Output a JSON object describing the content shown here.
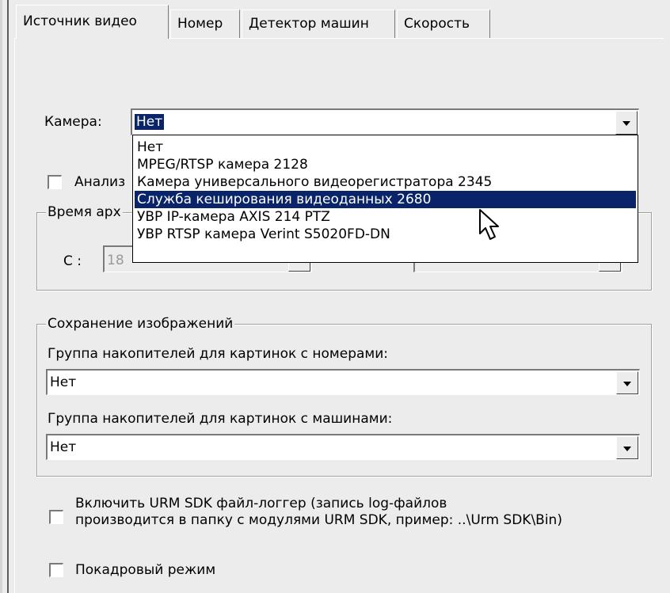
{
  "tabs": [
    {
      "label": "Источник видео"
    },
    {
      "label": "Номер"
    },
    {
      "label": "Детектор машин"
    },
    {
      "label": "Скорость"
    }
  ],
  "camera": {
    "label": "Камера:",
    "value": "Нет",
    "options": [
      "Нет",
      "MPEG/RTSP камера 2128",
      "Камера универсального видеорегистратора 2345",
      "Служба кеширования видеоданных 2680",
      "УВР IP-камера AXIS 214 PTZ",
      "УВР RTSP камера Verint S5020FD-DN"
    ],
    "highlighted_option": "Служба кеширования видеоданных 2680"
  },
  "analysis_checkbox": {
    "label": "Анализ",
    "checked": false
  },
  "archive_time": {
    "legend": "Время арх",
    "from_label": "С :",
    "from_value": "18"
  },
  "image_saving": {
    "legend": "Сохранение изображений",
    "plates_label": "Группа накопителей для картинок с номерами:",
    "plates_value": "Нет",
    "cars_label": "Группа накопителей для картинок с машинами:",
    "cars_value": "Нет"
  },
  "logger_checkbox": {
    "line1": "Включить URM SDK файл-логгер (запись log-файлов",
    "line2": "производится в папку с модулями URM SDK, пример: ..\\Urm SDK\\Bin)",
    "checked": false
  },
  "frame_mode_checkbox": {
    "label": "Покадровый режим",
    "checked": false
  },
  "colors": {
    "selection": "#0a246a",
    "background": "#ececec"
  }
}
